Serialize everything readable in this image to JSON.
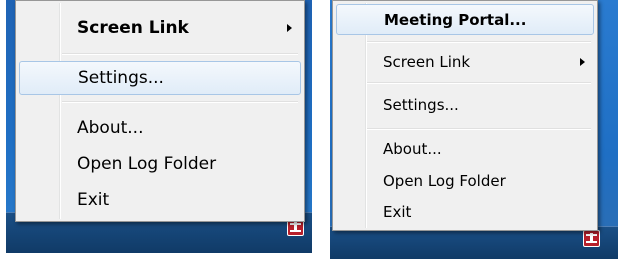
{
  "left_menu": {
    "items": [
      {
        "label": "Screen Link",
        "bold": true,
        "submenu": true
      },
      {
        "label": "Settings...",
        "bold": false,
        "highlighted": true
      },
      {
        "label": "About...",
        "bold": false
      },
      {
        "label": "Open Log Folder",
        "bold": false
      },
      {
        "label": "Exit",
        "bold": false
      }
    ],
    "tray_icon": "conference-tray-icon"
  },
  "right_menu": {
    "items": [
      {
        "label": "Meeting Portal...",
        "bold": true,
        "highlighted": true
      },
      {
        "label": "Screen Link",
        "bold": false,
        "submenu": true
      },
      {
        "label": "Settings...",
        "bold": false
      },
      {
        "label": "About...",
        "bold": false
      },
      {
        "label": "Open Log Folder",
        "bold": false
      },
      {
        "label": "Exit",
        "bold": false
      }
    ],
    "tray_icon": "conference-tray-icon"
  },
  "colors": {
    "desktop": "#1f6fc4",
    "taskbar": "#103a66",
    "menu_background": "#f0f0f0",
    "highlight": "#e0ecf8",
    "tray_icon": "#b7202b"
  }
}
